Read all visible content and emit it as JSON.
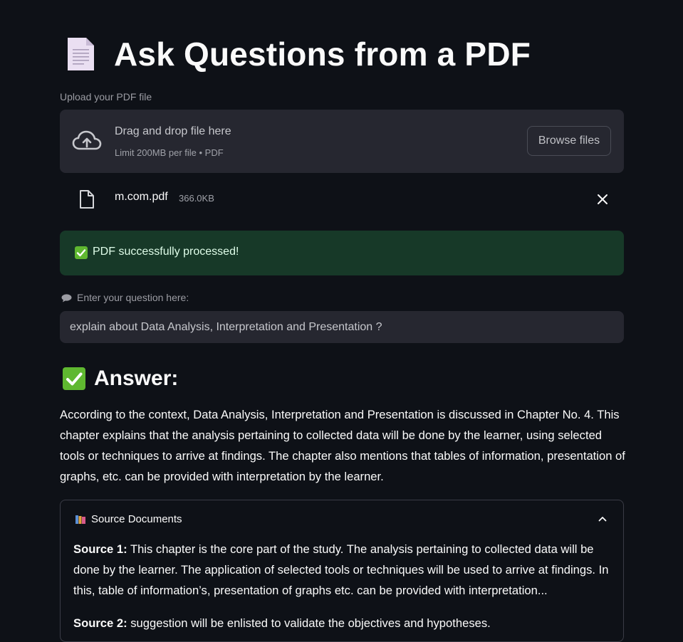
{
  "header": {
    "title": "Ask Questions from a PDF"
  },
  "upload": {
    "label": "Upload your PDF file",
    "drop_text": "Drag and drop file here",
    "limit_text": "Limit 200MB per file • PDF",
    "browse_label": "Browse files",
    "file_name": "m.com.pdf",
    "file_size": "366.0KB"
  },
  "status": {
    "success_text": "PDF successfully processed!",
    "color": "#173928"
  },
  "question": {
    "label": "Enter your question here:",
    "value": "explain about Data Analysis, Interpretation and Presentation ?"
  },
  "answer": {
    "heading": "Answer:",
    "body": "According to the context, Data Analysis, Interpretation and Presentation is discussed in Chapter No. 4. This chapter explains that the analysis pertaining to collected data will be done by the learner, using selected tools or techniques to arrive at findings. The chapter also mentions that tables of information, presentation of graphs, etc. can be provided with interpretation by the learner."
  },
  "sources": {
    "title": "Source Documents",
    "items": [
      {
        "label": "Source 1:",
        "text": "This chapter is the core part of the study. The analysis pertaining to collected data will be done by the learner. The application of selected tools or techniques will be used to arrive at findings. In this, table of information’s, presentation of graphs etc. can be provided with interpretation..."
      },
      {
        "label": "Source 2:",
        "text": "suggestion will be enlisted to validate the objectives and hypotheses."
      }
    ]
  },
  "icons": {
    "title": "page-facing-up-icon",
    "upload": "cloud-upload-icon",
    "file": "file-icon",
    "remove": "close-icon",
    "success": "check-mark-icon",
    "question": "speech-balloon-icon",
    "sources": "books-icon",
    "collapse": "chevron-up-icon"
  },
  "colors": {
    "background": "#0e1117",
    "surface": "#262730",
    "success_green": "#5fb830"
  }
}
